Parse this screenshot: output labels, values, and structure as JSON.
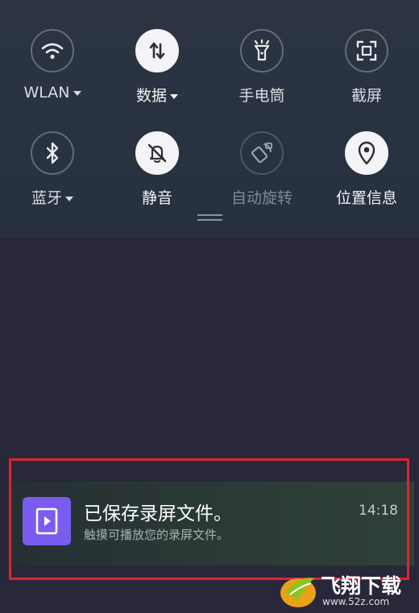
{
  "quick_settings": {
    "tiles": [
      {
        "label": "WLAN",
        "icon": "wifi-icon",
        "state": "off",
        "has_dropdown": true
      },
      {
        "label": "数据",
        "icon": "mobile-data-icon",
        "state": "on",
        "has_dropdown": true
      },
      {
        "label": "手电筒",
        "icon": "flashlight-icon",
        "state": "off",
        "has_dropdown": false
      },
      {
        "label": "截屏",
        "icon": "screenshot-icon",
        "state": "off",
        "has_dropdown": false
      },
      {
        "label": "蓝牙",
        "icon": "bluetooth-icon",
        "state": "off",
        "has_dropdown": true
      },
      {
        "label": "静音",
        "icon": "mute-bell-icon",
        "state": "on",
        "has_dropdown": false
      },
      {
        "label": "自动旋转",
        "icon": "auto-rotate-icon",
        "state": "disabled",
        "has_dropdown": false
      },
      {
        "label": "位置信息",
        "icon": "location-icon",
        "state": "on",
        "has_dropdown": false
      }
    ]
  },
  "notification": {
    "title": "已保存录屏文件。",
    "subtitle": "触摸可播放您的录屏文件。",
    "time": "14:18",
    "app_icon": "screen-recorder-icon",
    "app_icon_color": "#7a5cf0"
  },
  "highlight_color": "#e0242c",
  "watermark": {
    "text": "飞翔下载",
    "url": "www.52z.com"
  }
}
